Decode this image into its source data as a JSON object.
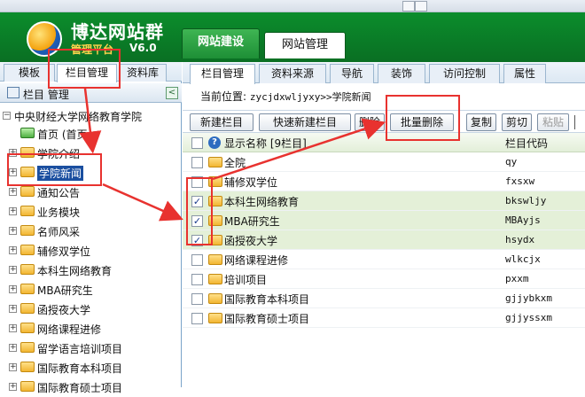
{
  "window": {
    "title_fragment": "博达网站群管理平台 · 栏目管理"
  },
  "brand": {
    "name": "博达网站群",
    "subtitle": "管理平台",
    "version": "V6.0"
  },
  "top_tabs": [
    {
      "label": "网站建设",
      "active": true
    },
    {
      "label": "网站管理",
      "active": false
    }
  ],
  "left_tabs": [
    {
      "label": "模板"
    },
    {
      "label": "栏目管理",
      "active": true
    },
    {
      "label": "资料库"
    }
  ],
  "left_header": {
    "label": "栏目  管理"
  },
  "tree": [
    {
      "label": "中央财经大学网络教育学院"
    },
    {
      "label": "首页 (首页"
    },
    {
      "label": "学院介绍"
    },
    {
      "label": "学院新闻",
      "selected": true
    },
    {
      "label": "通知公告"
    },
    {
      "label": "业务模块"
    },
    {
      "label": "名师风采"
    },
    {
      "label": "辅修双学位"
    },
    {
      "label": "本科生网络教育"
    },
    {
      "label": "MBA研究生"
    },
    {
      "label": "函授夜大学"
    },
    {
      "label": "网络课程进修"
    },
    {
      "label": "留学语言培训项目"
    },
    {
      "label": "国际教育本科项目"
    },
    {
      "label": "国际教育硕士项目"
    }
  ],
  "main_tabs": [
    {
      "label": "栏目管理",
      "active": true
    },
    {
      "label": "资料来源"
    },
    {
      "label": "导航"
    },
    {
      "label": "装饰"
    },
    {
      "label": "访问控制"
    },
    {
      "label": "属性"
    }
  ],
  "breadcrumb": {
    "prefix": "当前位置:",
    "path": "zycjdxwljyxy>>学院新闻"
  },
  "buttons": [
    {
      "label": "新建栏目"
    },
    {
      "label": "快速新建栏目"
    },
    {
      "label": "删除"
    },
    {
      "label": "批量删除"
    },
    {
      "label": "复制"
    },
    {
      "label": "剪切"
    },
    {
      "label": "粘贴",
      "disabled": true
    }
  ],
  "grid": {
    "header": {
      "name": "显示名称 [9栏目]",
      "code": "栏目代码"
    },
    "rows": [
      {
        "name": "全院",
        "code": "qy",
        "checked": false
      },
      {
        "name": "辅修双学位",
        "code": "fxsxw",
        "checked": false
      },
      {
        "name": "本科生网络教育",
        "code": "bkswljy",
        "checked": true
      },
      {
        "name": "MBA研究生",
        "code": "MBAyjs",
        "checked": true
      },
      {
        "name": "函授夜大学",
        "code": "hsydx",
        "checked": true
      },
      {
        "name": "网络课程进修",
        "code": "wlkcjx",
        "checked": false
      },
      {
        "name": "培训项目",
        "code": "pxxm",
        "checked": false
      },
      {
        "name": "国际教育本科项目",
        "code": "gjjybkxm",
        "checked": false
      },
      {
        "name": "国际教育硕士项目",
        "code": "gjjyssxm",
        "checked": false
      }
    ]
  },
  "colors": {
    "header_green": "#0a7a27",
    "annotation_red": "#e8322f",
    "selection_blue": "#1b4fa0"
  }
}
